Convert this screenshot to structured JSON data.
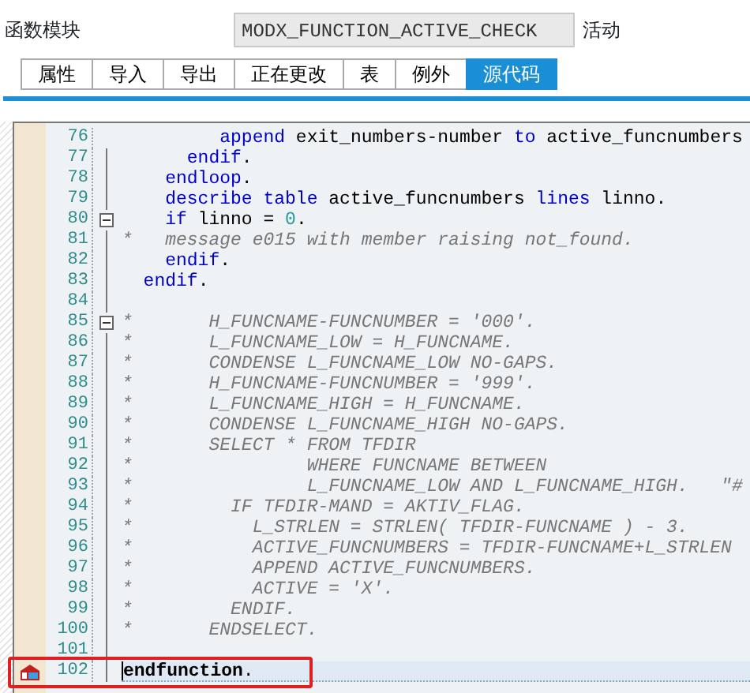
{
  "header": {
    "label": "函数模块",
    "field_value": "MODX_FUNCTION_ACTIVE_CHECK",
    "status": "活动"
  },
  "tabs": [
    {
      "label": "属性",
      "selected": false
    },
    {
      "label": "导入",
      "selected": false
    },
    {
      "label": "导出",
      "selected": false
    },
    {
      "label": "正在更改",
      "selected": false
    },
    {
      "label": "表",
      "selected": false
    },
    {
      "label": "例外",
      "selected": false
    },
    {
      "label": "源代码",
      "selected": true
    }
  ],
  "code_lines": [
    {
      "number": "76",
      "tokens": [
        {
          "kind": "keyword",
          "text": "         append"
        },
        {
          "kind": "plain",
          "text": " exit_numbers-number "
        },
        {
          "kind": "keyword",
          "text": "to"
        },
        {
          "kind": "plain",
          "text": " active_funcnumbers"
        }
      ]
    },
    {
      "number": "77",
      "tokens": [
        {
          "kind": "keyword",
          "text": "      endif"
        },
        {
          "kind": "plain",
          "text": "."
        }
      ]
    },
    {
      "number": "78",
      "tokens": [
        {
          "kind": "keyword",
          "text": "    endloop"
        },
        {
          "kind": "plain",
          "text": "."
        }
      ]
    },
    {
      "number": "79",
      "tokens": [
        {
          "kind": "keyword",
          "text": "    describe table"
        },
        {
          "kind": "plain",
          "text": " active_funcnumbers "
        },
        {
          "kind": "keyword",
          "text": "lines"
        },
        {
          "kind": "plain",
          "text": " linno."
        }
      ]
    },
    {
      "number": "80",
      "foldable": true,
      "tokens": [
        {
          "kind": "keyword",
          "text": "    if"
        },
        {
          "kind": "plain",
          "text": " linno = "
        },
        {
          "kind": "number",
          "text": "0"
        },
        {
          "kind": "plain",
          "text": "."
        }
      ]
    },
    {
      "number": "81",
      "tokens": [
        {
          "kind": "comment",
          "text": "*   message e015 with member raising not_found."
        }
      ]
    },
    {
      "number": "82",
      "tokens": [
        {
          "kind": "keyword",
          "text": "    endif"
        },
        {
          "kind": "plain",
          "text": "."
        }
      ]
    },
    {
      "number": "83",
      "tokens": [
        {
          "kind": "keyword",
          "text": "  endif"
        },
        {
          "kind": "plain",
          "text": "."
        }
      ]
    },
    {
      "number": "84"
    },
    {
      "number": "85",
      "foldable": true,
      "tokens": [
        {
          "kind": "comment",
          "text": "*       H_FUNCNAME-FUNCNUMBER = '000'."
        }
      ]
    },
    {
      "number": "86",
      "tokens": [
        {
          "kind": "comment",
          "text": "*       L_FUNCNAME_LOW = H_FUNCNAME."
        }
      ]
    },
    {
      "number": "87",
      "tokens": [
        {
          "kind": "comment",
          "text": "*       CONDENSE L_FUNCNAME_LOW NO-GAPS."
        }
      ]
    },
    {
      "number": "88",
      "tokens": [
        {
          "kind": "comment",
          "text": "*       H_FUNCNAME-FUNCNUMBER = '999'."
        }
      ]
    },
    {
      "number": "89",
      "tokens": [
        {
          "kind": "comment",
          "text": "*       L_FUNCNAME_HIGH = H_FUNCNAME."
        }
      ]
    },
    {
      "number": "90",
      "tokens": [
        {
          "kind": "comment",
          "text": "*       CONDENSE L_FUNCNAME_HIGH NO-GAPS."
        }
      ]
    },
    {
      "number": "91",
      "tokens": [
        {
          "kind": "comment",
          "text": "*       SELECT * FROM TFDIR"
        }
      ]
    },
    {
      "number": "92",
      "tokens": [
        {
          "kind": "comment",
          "text": "*                WHERE FUNCNAME BETWEEN"
        }
      ]
    },
    {
      "number": "93",
      "tokens": [
        {
          "kind": "comment",
          "text": "*                L_FUNCNAME_LOW AND L_FUNCNAME_HIGH.   \"#"
        }
      ]
    },
    {
      "number": "94",
      "tokens": [
        {
          "kind": "comment",
          "text": "*         IF TFDIR-MAND = AKTIV_FLAG."
        }
      ]
    },
    {
      "number": "95",
      "tokens": [
        {
          "kind": "comment",
          "text": "*           L_STRLEN = STRLEN( TFDIR-FUNCNAME ) - 3."
        }
      ]
    },
    {
      "number": "96",
      "tokens": [
        {
          "kind": "comment",
          "text": "*           ACTIVE_FUNCNUMBERS = TFDIR-FUNCNAME+L_STRLEN"
        }
      ]
    },
    {
      "number": "97",
      "tokens": [
        {
          "kind": "comment",
          "text": "*           APPEND ACTIVE_FUNCNUMBERS."
        }
      ]
    },
    {
      "number": "98",
      "tokens": [
        {
          "kind": "comment",
          "text": "*           ACTIVE = 'X'."
        }
      ]
    },
    {
      "number": "99",
      "tokens": [
        {
          "kind": "comment",
          "text": "*         ENDIF."
        }
      ]
    },
    {
      "number": "100",
      "tokens": [
        {
          "kind": "comment",
          "text": "*       ENDSELECT."
        }
      ]
    },
    {
      "number": "101"
    },
    {
      "number": "102",
      "current": true,
      "breakpoint": true,
      "highlighted": true,
      "tokens": [
        {
          "kind": "keyword-bold",
          "text": "endfunction"
        },
        {
          "kind": "plain",
          "text": "."
        }
      ]
    }
  ]
}
